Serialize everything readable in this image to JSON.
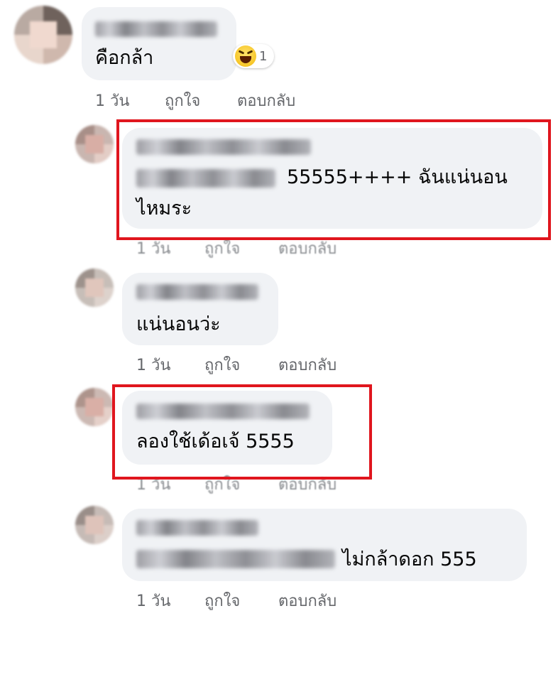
{
  "comments": [
    {
      "id": "c1",
      "reply": false,
      "text_lines": [
        "คือกล้า"
      ],
      "reaction": {
        "icon": "haha-emoji-icon",
        "count": "1"
      },
      "time": "1 วัน",
      "like": "ถูกใจ",
      "reply_label": "ตอบกลับ",
      "highlighted": false
    },
    {
      "id": "c2",
      "reply": true,
      "text_lines": [
        "55555++++ ฉันแน่นอน",
        "ไหมระ"
      ],
      "time": "1 วัน",
      "like": "ถูกใจ",
      "reply_label": "ตอบกลับ",
      "highlighted": true
    },
    {
      "id": "c3",
      "reply": true,
      "text_lines": [
        "แน่นอนว่ะ"
      ],
      "time": "1 วัน",
      "like": "ถูกใจ",
      "reply_label": "ตอบกลับ",
      "highlighted": false
    },
    {
      "id": "c4",
      "reply": true,
      "text_lines": [
        "ลองใช้เด้อเจ้ 5555"
      ],
      "time": "1 วัน",
      "like": "ถูกใจ",
      "reply_label": "ตอบกลับ",
      "highlighted": true
    },
    {
      "id": "c5",
      "reply": true,
      "text_lines": [
        "ไม่กล้าดอก  555"
      ],
      "time": "1 วัน",
      "like": "ถูกใจ",
      "reply_label": "ตอบกลับ",
      "highlighted": false
    }
  ],
  "colors": {
    "bubble": "#f0f2f5",
    "highlight": "#e0161e",
    "meta_text": "#65676b"
  }
}
